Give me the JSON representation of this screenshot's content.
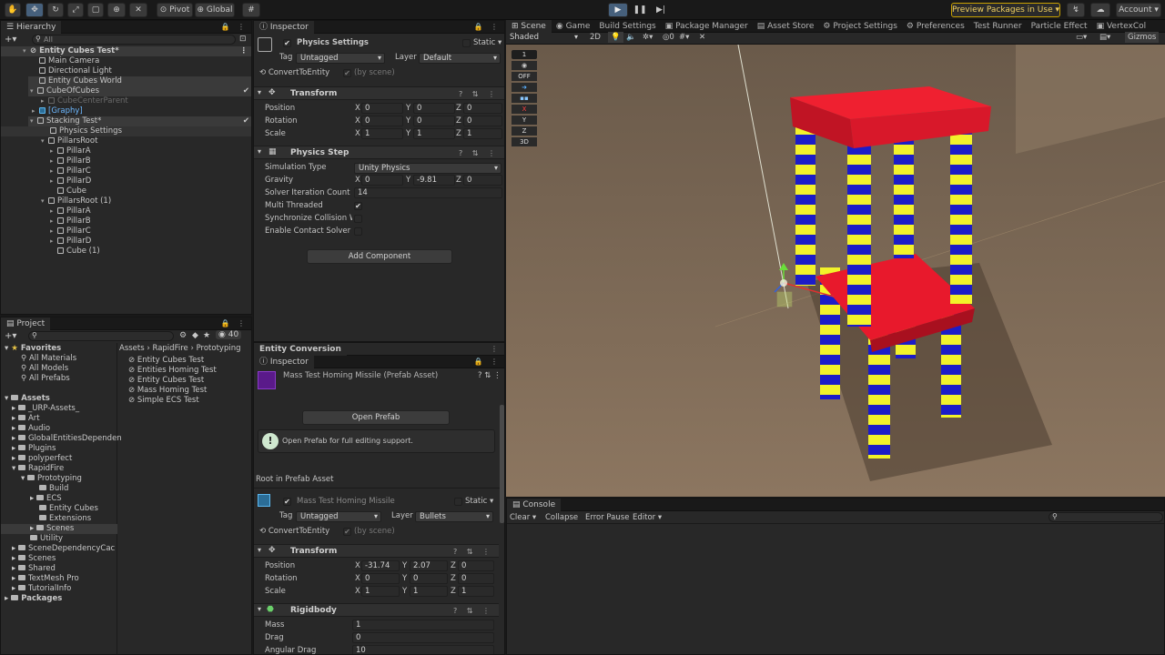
{
  "toolbar": {
    "pivot_label": "Pivot",
    "global_label": "Global",
    "preview_packages_label": "Preview Packages in Use",
    "account_label": "Account"
  },
  "hierarchy": {
    "tab_label": "Hierarchy",
    "search_placeholder": "All",
    "items": [
      {
        "label": "Entity Cubes Test*"
      },
      {
        "label": "Main Camera"
      },
      {
        "label": "Directional Light"
      },
      {
        "label": "Entity Cubes World"
      },
      {
        "label": "CubeOfCubes"
      },
      {
        "label": "CubeCenterParent"
      },
      {
        "label": "[Graphy]"
      },
      {
        "label": "Stacking Test*"
      },
      {
        "label": "Physics Settings"
      },
      {
        "label": "PillarsRoot"
      },
      {
        "label": "PillarA"
      },
      {
        "label": "PillarB"
      },
      {
        "label": "PillarC"
      },
      {
        "label": "PillarD"
      },
      {
        "label": "Cube"
      },
      {
        "label": "PillarsRoot (1)"
      },
      {
        "label": "PillarA"
      },
      {
        "label": "PillarB"
      },
      {
        "label": "PillarC"
      },
      {
        "label": "PillarD"
      },
      {
        "label": "Cube (1)"
      }
    ]
  },
  "project": {
    "tab_label": "Project",
    "hidden_count": "40",
    "breadcrumb": [
      "Assets",
      "RapidFire",
      "Prototyping"
    ],
    "favorites_label": "Favorites",
    "favorites": [
      "All Materials",
      "All Models",
      "All Prefabs"
    ],
    "assets_label": "Assets",
    "tree": [
      "_URP-Assets_",
      "Art",
      "Audio",
      "GlobalEntitiesDependen",
      "Plugins",
      "polyperfect",
      "RapidFire",
      "Prototyping",
      "Build",
      "ECS",
      "Entity Cubes",
      "Extensions",
      "Scenes",
      "Utility",
      "SceneDependencyCac",
      "Scenes",
      "Shared",
      "TextMesh Pro",
      "TutorialInfo"
    ],
    "packages_label": "Packages",
    "files": [
      "Entity Cubes Test",
      "Entities Homing Test",
      "Entity Cubes Test",
      "Mass Homing Test",
      "Simple ECS Test"
    ]
  },
  "inspector_top": {
    "tab_label": "Inspector",
    "object_name": "Physics Settings",
    "static_label": "Static",
    "tag_label": "Tag",
    "tag_value": "Untagged",
    "layer_label": "Layer",
    "layer_value": "Default",
    "convert_label": "ConvertToEntity",
    "convert_hint": "(by scene)",
    "transform": {
      "title": "Transform",
      "position_label": "Position",
      "rotation_label": "Rotation",
      "scale_label": "Scale",
      "position": [
        "0",
        "0",
        "0"
      ],
      "rotation": [
        "0",
        "0",
        "0"
      ],
      "scale": [
        "1",
        "1",
        "1"
      ]
    },
    "physics_step": {
      "title": "Physics Step",
      "simulation_type_label": "Simulation Type",
      "simulation_type_value": "Unity Physics",
      "gravity_label": "Gravity",
      "gravity": [
        "0",
        "-9.81",
        "0"
      ],
      "solver_label": "Solver Iteration Count",
      "solver_value": "14",
      "multi_threaded_label": "Multi Threaded",
      "sync_label": "Synchronize Collision W",
      "contact_label": "Enable Contact Solver S"
    },
    "add_component_label": "Add Component"
  },
  "entity_conversion": {
    "tab_label": "Entity Conversion"
  },
  "inspector_bottom": {
    "tab_label": "Inspector",
    "prefab_title": "Mass Test Homing Missile (Prefab Asset)",
    "open_prefab_label": "Open Prefab",
    "info_text": "Open Prefab for full editing support.",
    "root_label": "Root in Prefab Asset",
    "object_name": "Mass Test Homing Missile",
    "static_label": "Static",
    "tag_label": "Tag",
    "tag_value": "Untagged",
    "layer_label": "Layer",
    "layer_value": "Bullets",
    "convert_label": "ConvertToEntity",
    "convert_hint": "(by scene)",
    "transform": {
      "title": "Transform",
      "position_label": "Position",
      "rotation_label": "Rotation",
      "scale_label": "Scale",
      "position": [
        "-31.74",
        "2.07",
        "0"
      ],
      "rotation": [
        "0",
        "0",
        "0"
      ],
      "scale": [
        "1",
        "1",
        "1"
      ]
    },
    "rigidbody": {
      "title": "Rigidbody",
      "mass_label": "Mass",
      "mass_value": "1",
      "drag_label": "Drag",
      "drag_value": "0",
      "angular_drag_label": "Angular Drag",
      "angular_drag_value": "10"
    }
  },
  "scene": {
    "tabs": [
      "Scene",
      "Game",
      "Build Settings",
      "Package Manager",
      "Asset Store",
      "Project Settings",
      "Preferences",
      "Test Runner",
      "Particle Effect",
      "VertexCol"
    ],
    "shading_mode": "Shaded",
    "mode_2d": "2D",
    "hidden_count": "0",
    "gizmos_label": "Gizmos",
    "overlay": [
      "1",
      "OFF",
      "X",
      "Y",
      "Z",
      "3D"
    ]
  },
  "console": {
    "tab_label": "Console",
    "clear_label": "Clear",
    "collapse_label": "Collapse",
    "error_pause_label": "Error Pause",
    "editor_label": "Editor"
  },
  "axis_labels": {
    "x": "X",
    "y": "Y",
    "z": "Z"
  },
  "colors": {
    "accent": "#46607c",
    "tower_red": "#e8192c",
    "stripe_yellow": "#f2f22a",
    "stripe_blue": "#1c1cc8",
    "ground": "#7e6a56"
  }
}
